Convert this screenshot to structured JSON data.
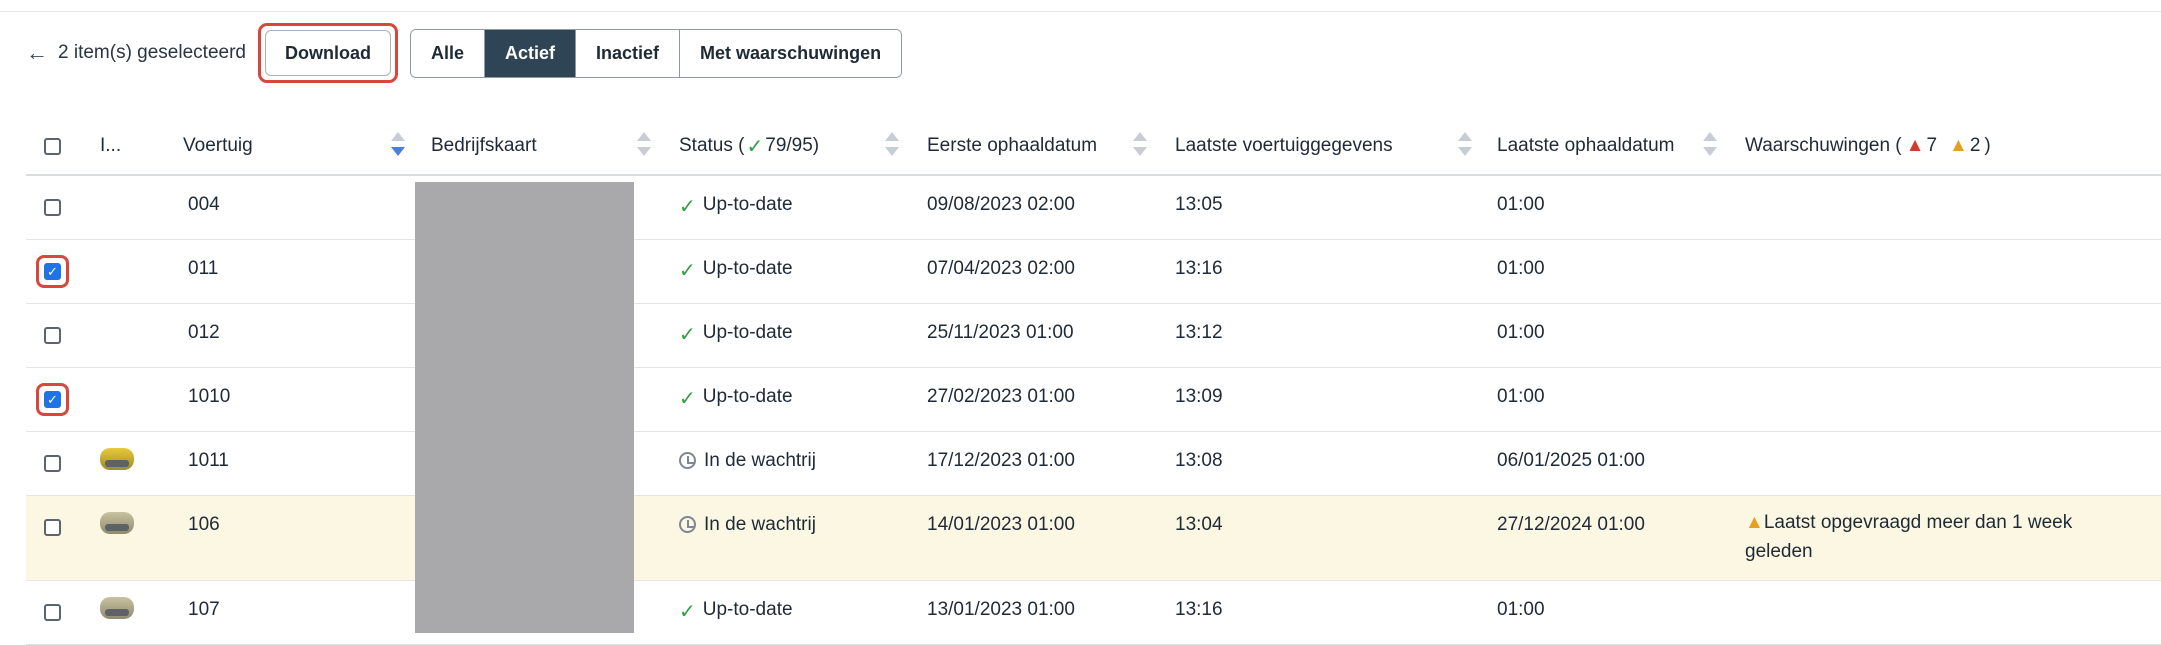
{
  "toolbar": {
    "back_label": "2 item(s) geselecteerd",
    "download_label": "Download",
    "filters": [
      "Alle",
      "Actief",
      "Inactief",
      "Met waarschuwingen"
    ],
    "active_filter": "Actief"
  },
  "table": {
    "columns": {
      "image": "I...",
      "vehicle": "Voertuig",
      "card": "Bedrijfskaart",
      "status": "Status (",
      "status_count": "79/95)",
      "first_date": "Eerste ophaaldatum",
      "last_vehicle_data": "Laatste voertuiggegevens",
      "last_date": "Laatste ophaaldatum",
      "warnings": "Waarschuwingen (",
      "warn_red_count": "7",
      "warn_yellow_count": "2",
      "warnings_close": ")"
    },
    "rows": [
      {
        "vehicle": "004",
        "status": "Up-to-date",
        "first_date": "09/08/2023 02:00",
        "last_vehicle_data": "13:05",
        "last_date": "01:00",
        "warning": ""
      },
      {
        "vehicle": "011",
        "status": "Up-to-date",
        "first_date": "07/04/2023 02:00",
        "last_vehicle_data": "13:16",
        "last_date": "01:00",
        "warning": ""
      },
      {
        "vehicle": "012",
        "status": "Up-to-date",
        "first_date": "25/11/2023 01:00",
        "last_vehicle_data": "13:12",
        "last_date": "01:00",
        "warning": ""
      },
      {
        "vehicle": "1010",
        "status": "Up-to-date",
        "first_date": "27/02/2023 01:00",
        "last_vehicle_data": "13:09",
        "last_date": "01:00",
        "warning": ""
      },
      {
        "vehicle": "1011",
        "status": "In de wachtrij",
        "first_date": "17/12/2023 01:00",
        "last_vehicle_data": "13:08",
        "last_date": "06/01/2025 01:00",
        "warning": ""
      },
      {
        "vehicle": "106",
        "status": "In de wachtrij",
        "first_date": "14/01/2023 01:00",
        "last_vehicle_data": "13:04",
        "last_date": "27/12/2024 01:00",
        "warning": "Laatst opgevraagd meer dan 1 week geleden"
      },
      {
        "vehicle": "107",
        "status": "Up-to-date",
        "first_date": "13/01/2023 01:00",
        "last_vehicle_data": "13:16",
        "last_date": "01:00",
        "warning": ""
      }
    ]
  },
  "colors": {
    "accent": "#2f4555",
    "highlight": "#d8463c",
    "checkbox": "#1e73e8",
    "ok": "#2f9e44",
    "row_warning": "#fbf7e3"
  }
}
